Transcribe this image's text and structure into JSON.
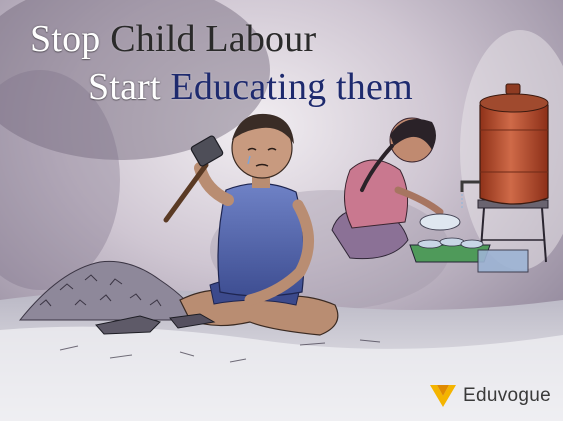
{
  "headline": {
    "line1": {
      "word1": "Stop",
      "word2": "Child Labour"
    },
    "line2": {
      "word1": "Start",
      "word2": "Educating them"
    }
  },
  "brand": {
    "name": "Eduvogue",
    "logo_icon": "v-chevron-logo-icon",
    "logo_color": "#f4b400"
  },
  "colors": {
    "highlight_white": "#ffffff",
    "highlight_dark": "#2a2a2a",
    "highlight_navy": "#1e2a6e",
    "barrel_red": "#b84a2c"
  },
  "illustration": {
    "subjects": [
      "boy-breaking-stones",
      "girl-washing-dishes",
      "water-barrel",
      "stone-pile",
      "hammer"
    ]
  }
}
